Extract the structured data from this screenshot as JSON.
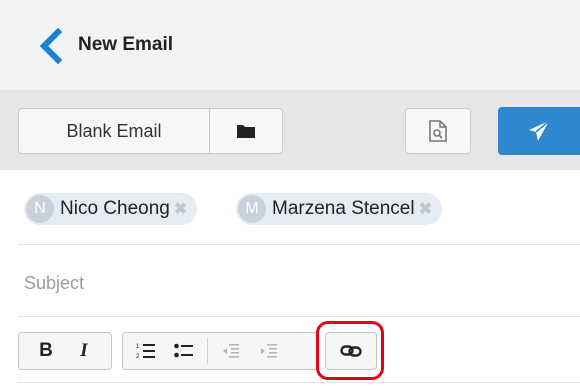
{
  "header": {
    "title": "New Email",
    "back_icon": "chevron-left-icon"
  },
  "toolbar": {
    "template_label": "Blank Email",
    "folder_icon": "folder-icon",
    "preview_icon": "document-preview-icon",
    "send_icon": "paper-plane-icon"
  },
  "recipients": [
    {
      "initial": "N",
      "name": "Nico Cheong"
    },
    {
      "initial": "M",
      "name": "Marzena Stencel"
    }
  ],
  "subject": {
    "value": "",
    "placeholder": "Subject"
  },
  "formatting": {
    "bold_label": "B",
    "italic_label": "I",
    "ordered_list_icon": "ordered-list-icon",
    "unordered_list_icon": "unordered-list-icon",
    "outdent_icon": "outdent-icon",
    "indent_icon": "indent-icon",
    "link_icon": "link-icon"
  },
  "colors": {
    "accent": "#2f87d0",
    "highlight": "#e3001b"
  }
}
